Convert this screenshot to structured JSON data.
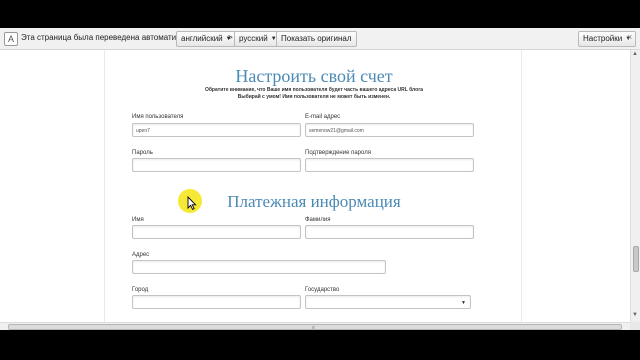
{
  "translate_bar": {
    "icon": "translate-icon",
    "message": "Эта страница была переведена автоматически",
    "source_language": "английский",
    "arrow": ">",
    "target_language": "русский",
    "show_original": "Показать оригинал",
    "settings": "Настройки",
    "close": "×"
  },
  "account": {
    "title": "Настроить свой счет",
    "note_line1": "Обратите внимание, что Ваше имя пользователя будет часть вашего адреса URL блога",
    "note_line2": "Выбирай с умом! Имя пользователя не может быть изменен.",
    "username_label": "Имя пользователя",
    "username_value": "upen7",
    "email_label": "E-mail адрес",
    "email_value": "semenow21@gmail.com",
    "password_label": "Пароль",
    "password_value": "",
    "confirm_label": "Подтверждение пароля",
    "confirm_value": ""
  },
  "billing": {
    "title": "Платежная информация",
    "first_name_label": "Имя",
    "last_name_label": "Фамилия",
    "address_label": "Адрес",
    "city_label": "Город",
    "country_label": "Государство",
    "country_value": ""
  },
  "scrollbar": {
    "up": "▲",
    "down": "▼",
    "grip": "≡"
  }
}
